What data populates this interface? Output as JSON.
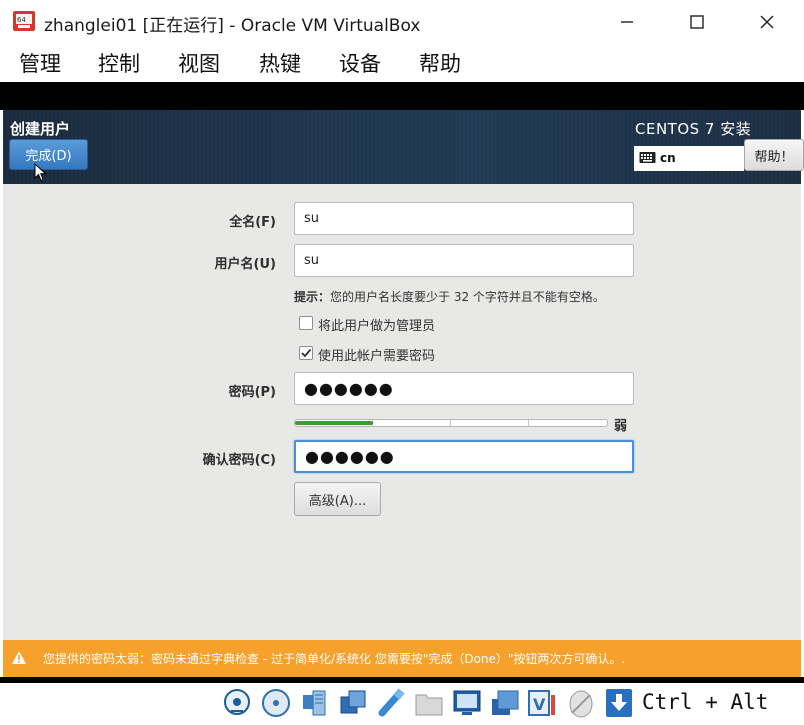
{
  "window": {
    "title": "zhanglei01 [正在运行] - Oracle VM VirtualBox"
  },
  "menu": [
    "管理",
    "控制",
    "视图",
    "热键",
    "设备",
    "帮助"
  ],
  "header": {
    "spoke_title": "创建用户",
    "done_label": "完成(D)",
    "product_title": "CENTOS 7 安装",
    "keyboard_layout": "cn",
    "help_label": "帮助！"
  },
  "form": {
    "fullname_label": "全名(F)",
    "fullname_value": "su",
    "username_label": "用户名(U)",
    "username_value": "su",
    "hint_bold": "提示：",
    "hint_text": "您的用户名长度要少于 32 个字符并且不能有空格。",
    "admin_checkbox_label": "将此用户做为管理员",
    "admin_checked": false,
    "require_password_label": "使用此帐户需要密码",
    "require_password_checked": true,
    "password_label": "密码(P)",
    "password_mask": "●●●●●●",
    "strength_label": "弱",
    "strength_fraction": 0.25,
    "confirm_label": "确认密码(C)",
    "confirm_mask": "●●●●●●",
    "advanced_label": "高级(A)..."
  },
  "warning": {
    "text": "您提供的密码太弱：密码未通过字典检查 - 过于简单化/系统化 您需要按\"完成（Done）\"按钮两次方可确认。."
  },
  "statusbar": {
    "host_key": "Ctrl + Alt"
  },
  "colors": {
    "accent": "#3578c0",
    "warning": "#f6a12b",
    "strength": "#3e9a31"
  }
}
